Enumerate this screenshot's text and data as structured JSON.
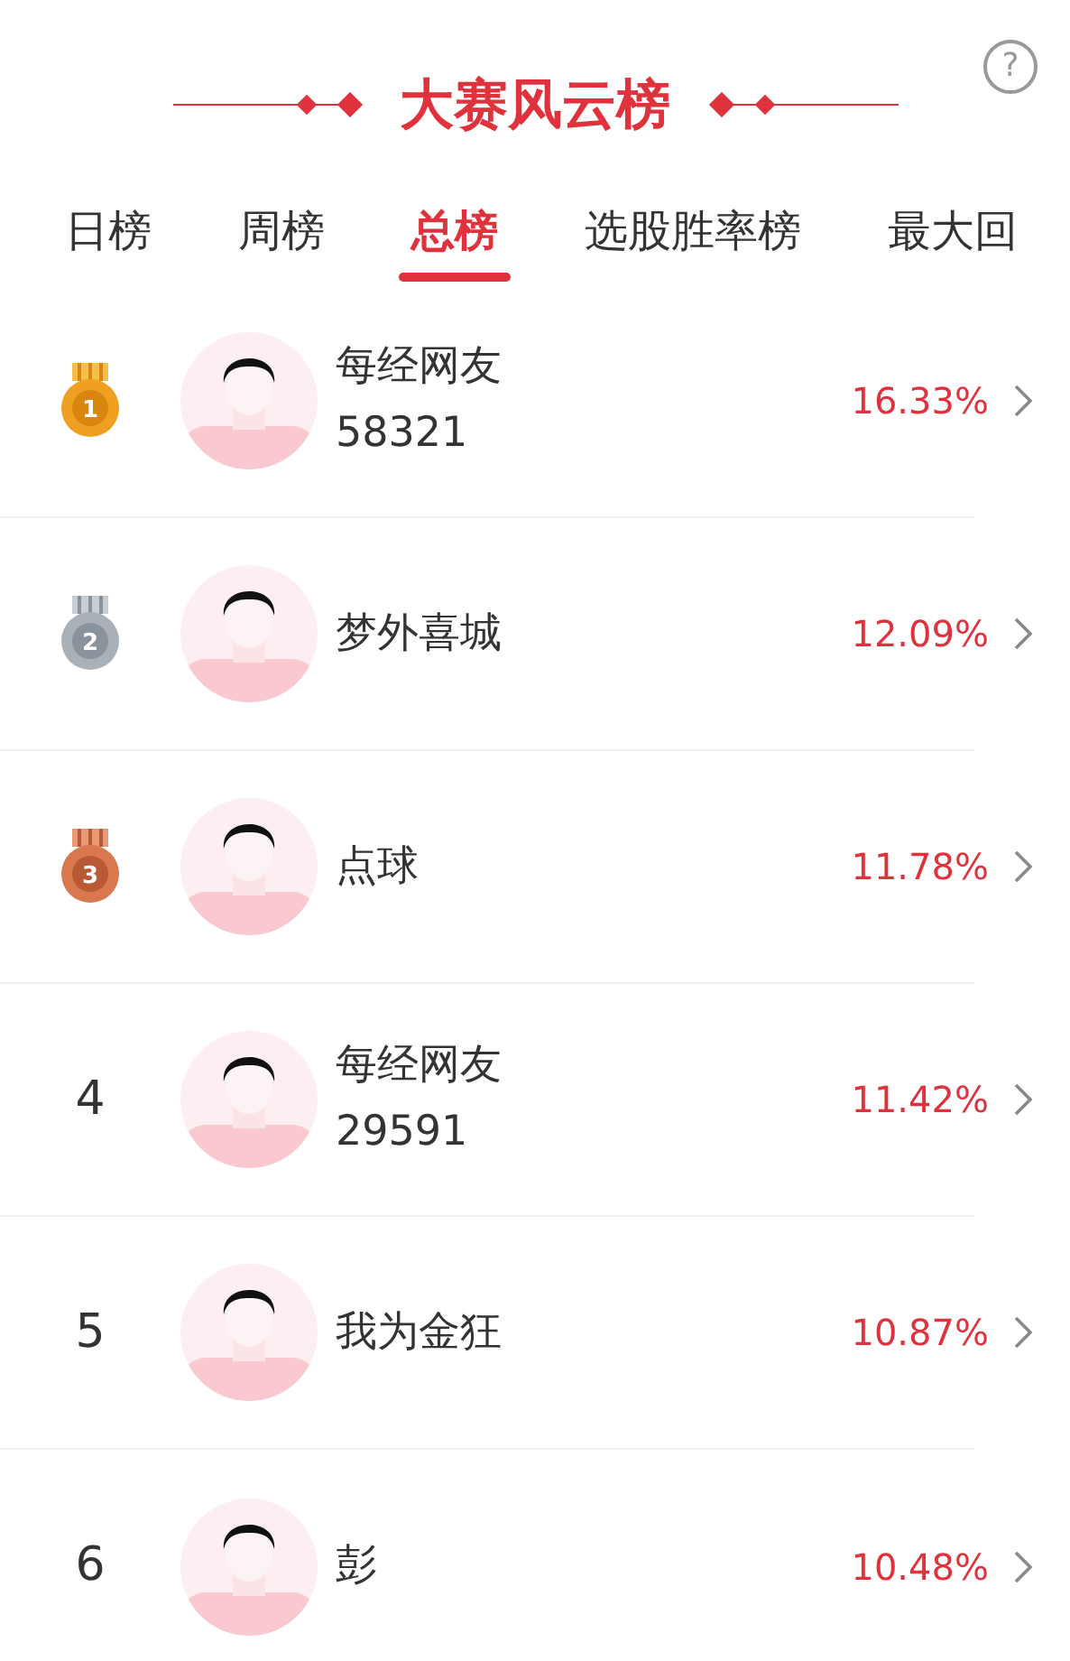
{
  "title": "大赛风云榜",
  "help": "?",
  "tabs": [
    {
      "label": "日榜",
      "selected": false
    },
    {
      "label": "周榜",
      "selected": false
    },
    {
      "label": "总榜",
      "selected": true
    },
    {
      "label": "选股胜率榜",
      "selected": false
    },
    {
      "label": "最大回",
      "selected": false
    }
  ],
  "rows": [
    {
      "kind": "gold",
      "rank": "1",
      "name": "每经网友58321",
      "rate": "16.33%"
    },
    {
      "kind": "silver",
      "rank": "2",
      "name": "梦外喜城",
      "rate": "12.09%"
    },
    {
      "kind": "bronze",
      "rank": "3",
      "name": "点球",
      "rate": "11.78%"
    },
    {
      "kind": "plain",
      "rank": "4",
      "name": "每经网友29591",
      "rate": "11.42%"
    },
    {
      "kind": "plain",
      "rank": "5",
      "name": "我为金狂",
      "rate": "10.87%"
    },
    {
      "kind": "plain",
      "rank": "6",
      "name": "彭",
      "rate": "10.48%"
    }
  ]
}
